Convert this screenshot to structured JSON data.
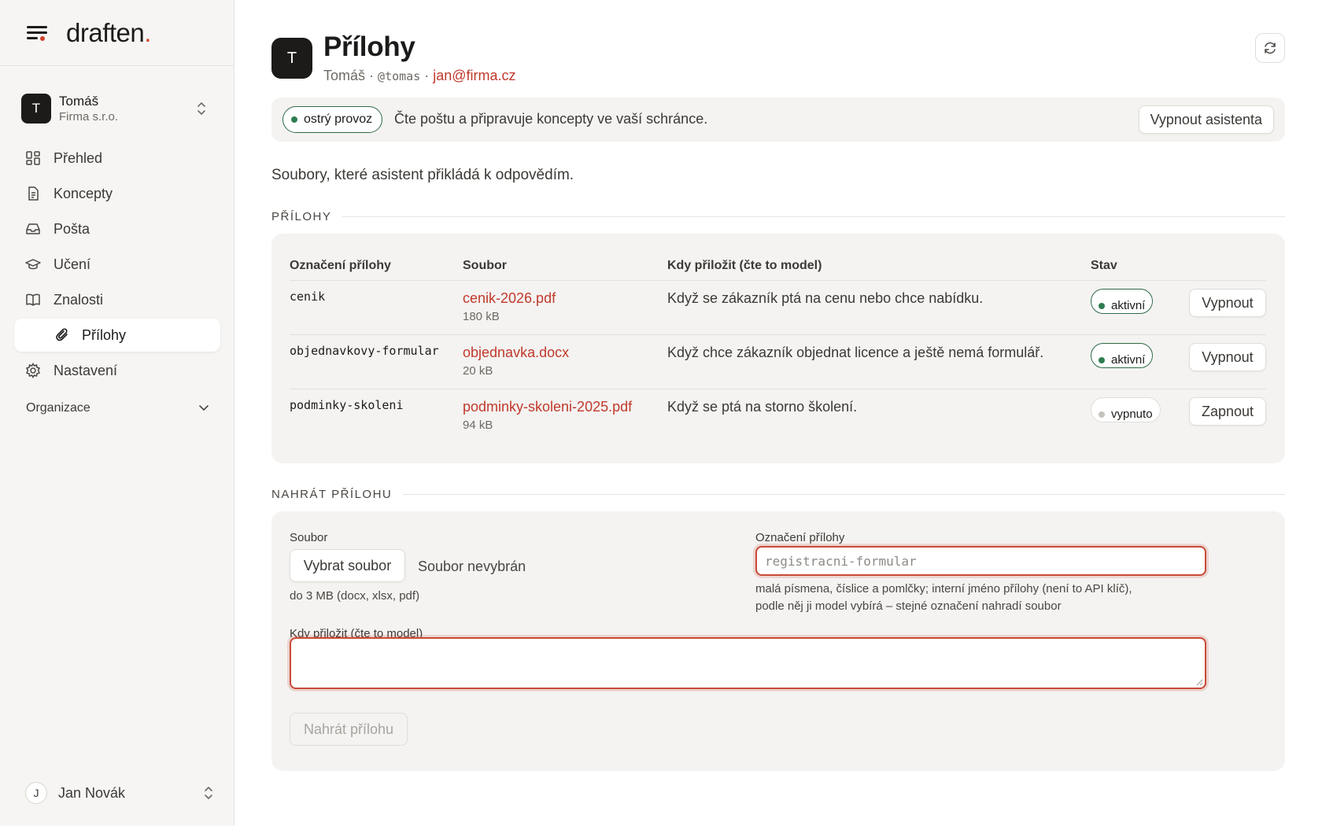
{
  "brand": {
    "name": "draften",
    "dot": "."
  },
  "account": {
    "initial": "T",
    "name": "Tomáš",
    "org": "Firma s.r.o."
  },
  "nav": {
    "items": [
      {
        "label": "Přehled",
        "icon": "dashboard-icon"
      },
      {
        "label": "Koncepty",
        "icon": "document-icon"
      },
      {
        "label": "Pošta",
        "icon": "inbox-icon"
      },
      {
        "label": "Učení",
        "icon": "graduation-cap-icon"
      },
      {
        "label": "Znalosti",
        "icon": "book-icon"
      }
    ],
    "active_sub": {
      "label": "Přílohy",
      "icon": "paperclip-icon"
    },
    "settings": {
      "label": "Nastavení",
      "icon": "gear-icon"
    },
    "group": {
      "label": "Organizace",
      "icon": "chevron-down-icon"
    }
  },
  "user": {
    "initial": "J",
    "name": "Jan Novák"
  },
  "header": {
    "avatar": "T",
    "title": "Přílohy",
    "name": "Tomáš",
    "sep": "·",
    "handle": "@tomas",
    "email": "jan@firma.cz"
  },
  "status": {
    "pill": "ostrý provoz",
    "text": "Čte poštu a připravuje koncepty ve vaší schránce.",
    "button": "Vypnout asistenta"
  },
  "intro": "Soubory, které asistent přikládá k odpovědím.",
  "attachments": {
    "section_title": "PŘÍLOHY",
    "columns": [
      "Označení přílohy",
      "Soubor",
      "Kdy přiložit (čte to model)",
      "Stav"
    ],
    "rows": [
      {
        "label": "cenik",
        "file": "cenik-2026.pdf",
        "size": "180 kB",
        "when": "Když se zákazník ptá na cenu nebo chce nabídku.",
        "state": "aktivní",
        "active": true,
        "action": "Vypnout"
      },
      {
        "label": "objednavkovy-formular",
        "file": "objednavka.docx",
        "size": "20 kB",
        "when": "Když chce zákazník objednat licence a ještě nemá formulář.",
        "state": "aktivní",
        "active": true,
        "action": "Vypnout"
      },
      {
        "label": "podminky-skoleni",
        "file": "podminky-skoleni-2025.pdf",
        "size": "94 kB",
        "when": "Když se ptá na storno školení.",
        "state": "vypnuto",
        "active": false,
        "action": "Zapnout"
      }
    ]
  },
  "upload": {
    "section_title": "NAHRÁT PŘÍLOHU",
    "file_label": "Soubor",
    "file_button": "Vybrat soubor",
    "file_none": "Soubor nevybrán",
    "file_hint": "do 3 MB (docx, xlsx, pdf)",
    "name_label": "Označení přílohy",
    "name_placeholder": "registracni-formular",
    "name_hint_1": "malá písmena, číslice a pomlčky; interní jméno přílohy (není to API klíč),",
    "name_hint_2": "podle něj ji model vybírá – stejné označení nahradí soubor",
    "when_label": "Kdy přiložit (čte to model)",
    "when_value": "",
    "submit": "Nahrát přílohu"
  },
  "colors": {
    "accent": "#c0392b",
    "brand_dot": "#d2412c",
    "active_green": "#2e7d4f"
  }
}
